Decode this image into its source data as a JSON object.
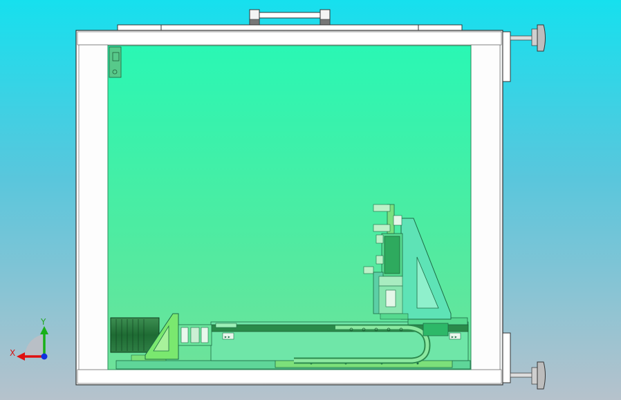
{
  "triad": {
    "x_label": "X",
    "y_label": "Y",
    "colors": {
      "x": "#e01010",
      "y": "#18b018",
      "z": "#1030e0"
    }
  },
  "colors": {
    "background_top": "#16e0ee",
    "background_bottom": "#b6c2cc",
    "enclosure_glass": "#2ef5b2",
    "frame": "#ffffff",
    "components": "#62df86",
    "dark_parts": "#1c7a3c"
  }
}
